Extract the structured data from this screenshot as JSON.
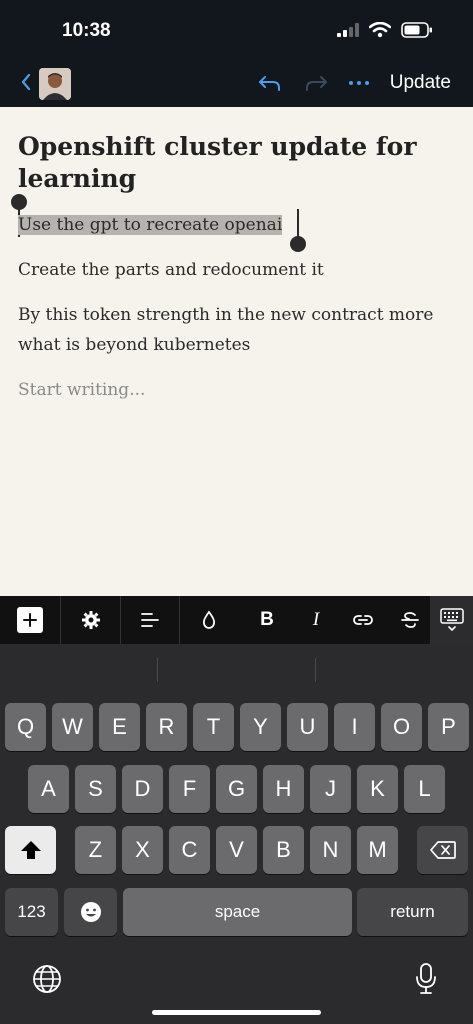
{
  "status_bar": {
    "time": "10:38"
  },
  "nav": {
    "update_label": "Update"
  },
  "document": {
    "title": "Openshift cluster update for learning",
    "paragraphs": [
      "Use the gpt to recreate openai",
      "Create the parts and redocument it",
      "By this token strength in the new contract more what is beyond kubernetes"
    ],
    "placeholder": "Start writing..."
  },
  "toolbar": {
    "bold_label": "B",
    "italic_label": "I"
  },
  "keyboard": {
    "row1": [
      "Q",
      "W",
      "E",
      "R",
      "T",
      "Y",
      "U",
      "I",
      "O",
      "P"
    ],
    "row2": [
      "A",
      "S",
      "D",
      "F",
      "G",
      "H",
      "J",
      "K",
      "L"
    ],
    "row3": [
      "Z",
      "X",
      "C",
      "V",
      "B",
      "N",
      "M"
    ],
    "numbers_label": "123",
    "space_label": "space",
    "return_label": "return"
  },
  "colors": {
    "editor_bg": "#f6f3ec",
    "accent": "#4a9ee8",
    "selection": "#b6b3ae"
  }
}
